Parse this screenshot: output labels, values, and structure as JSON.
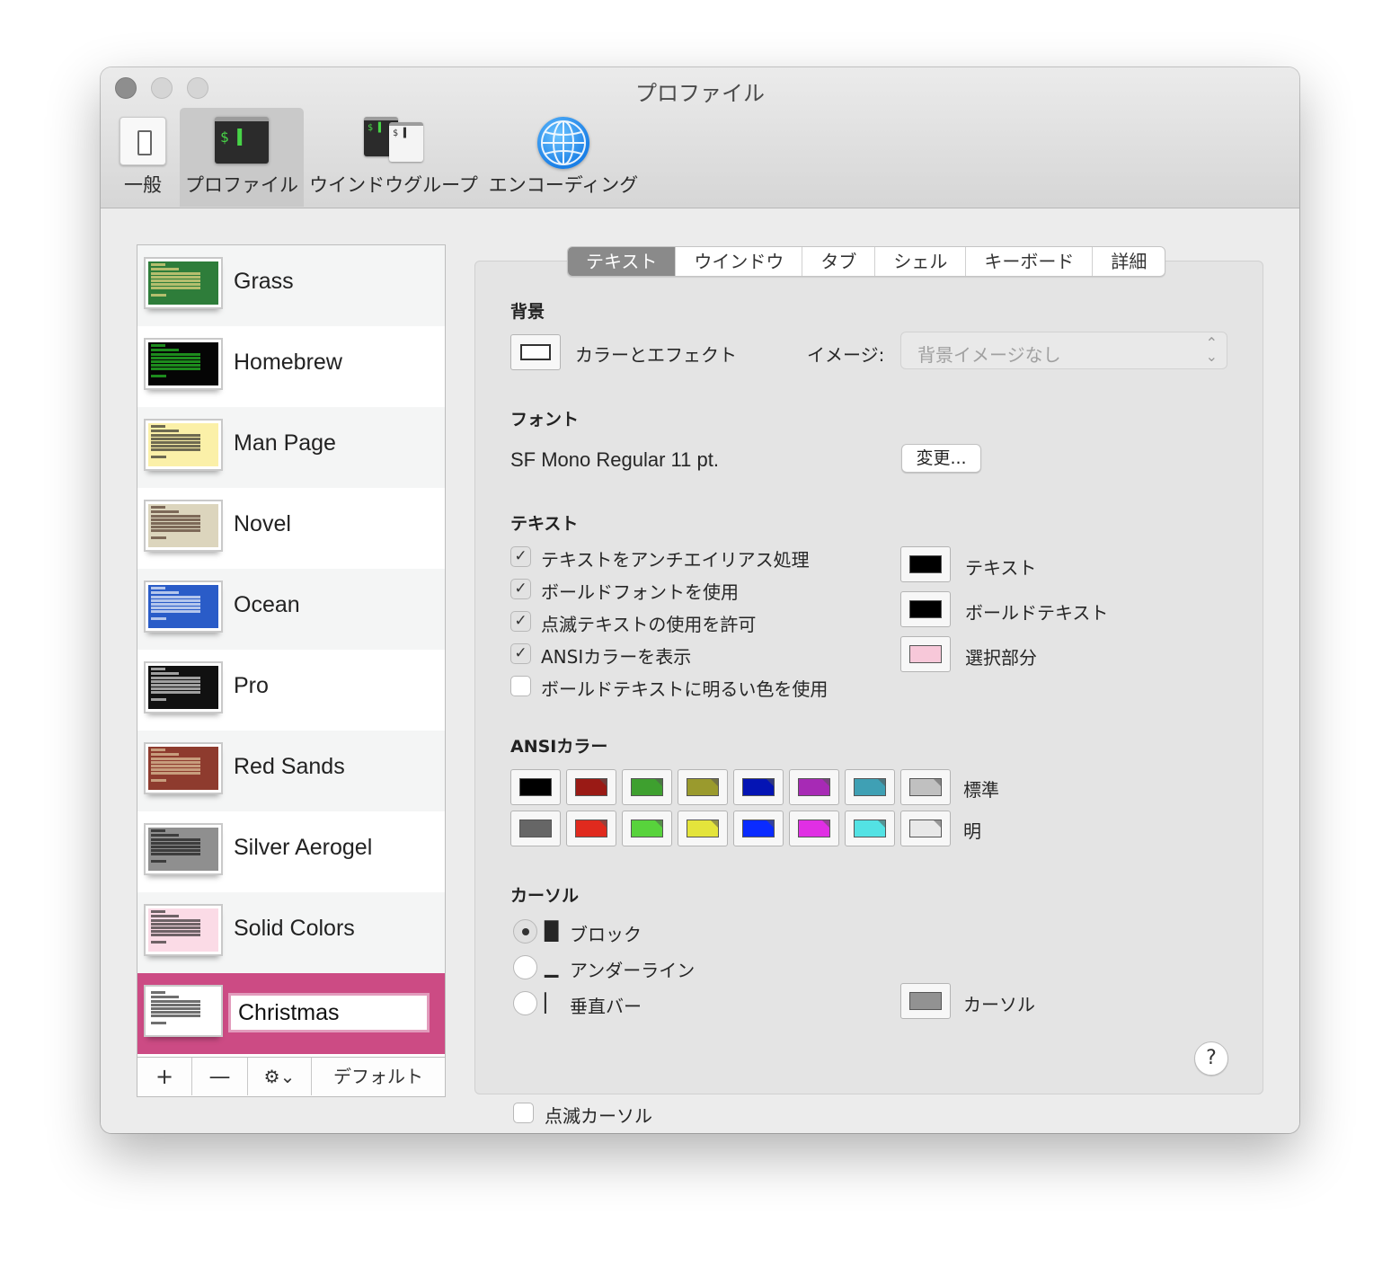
{
  "window": {
    "title": "プロファイル"
  },
  "toolbar": {
    "items": [
      {
        "label": "一般",
        "icon": "general-settings-icon"
      },
      {
        "label": "プロファイル",
        "icon": "terminal-window-icon",
        "selected": true
      },
      {
        "label": "ウインドウグループ",
        "icon": "window-group-icon"
      },
      {
        "label": "エンコーディング",
        "icon": "globe-icon"
      }
    ],
    "term_prompt": "$ ▌",
    "term_prompt_small": "$ ▌"
  },
  "profiles": {
    "items": [
      {
        "name": "Grass",
        "bg": "#2e7d3a",
        "fg": "#fde28b"
      },
      {
        "name": "Homebrew",
        "bg": "#050505",
        "fg": "#2bd62b"
      },
      {
        "name": "Man Page",
        "bg": "#fbf0a8",
        "fg": "#222222"
      },
      {
        "name": "Novel",
        "bg": "#dcd5bd",
        "fg": "#4a2f22"
      },
      {
        "name": "Ocean",
        "bg": "#2a5cc8",
        "fg": "#ffffff"
      },
      {
        "name": "Pro",
        "bg": "#111111",
        "fg": "#eeeeee"
      },
      {
        "name": "Red Sands",
        "bg": "#8e3b2e",
        "fg": "#e7d3a8"
      },
      {
        "name": "Silver Aerogel",
        "bg": "#8f8f8f",
        "fg": "#111111"
      },
      {
        "name": "Solid Colors",
        "bg": "#fbdbe6",
        "fg": "#222222"
      },
      {
        "name": "Christmas",
        "bg": "#ffffff",
        "fg": "#222222",
        "selected": true,
        "editing": true
      }
    ],
    "toolbar": {
      "add": "+",
      "remove": "—",
      "gear": "⚙⌄",
      "default": "デフォルト"
    }
  },
  "tabs": [
    "テキスト",
    "ウインドウ",
    "タブ",
    "シェル",
    "キーボード",
    "詳細"
  ],
  "active_tab": "テキスト",
  "background": {
    "title": "背景",
    "color_effects_label": "カラーとエフェクト",
    "image_label": "イメージ:",
    "image_value": "背景イメージなし",
    "arrows": "⌃⌄"
  },
  "font": {
    "title": "フォント",
    "value": "SF Mono Regular 11 pt.",
    "change_button": "変更..."
  },
  "text": {
    "title": "テキスト",
    "options": [
      {
        "label": "テキストをアンチエイリアス処理",
        "checked": true
      },
      {
        "label": "ボールドフォントを使用",
        "checked": true
      },
      {
        "label": "点滅テキストの使用を許可",
        "checked": true
      },
      {
        "label": "ANSIカラーを表示",
        "checked": true
      },
      {
        "label": "ボールドテキストに明るい色を使用",
        "checked": false
      }
    ],
    "check_mark": "✓",
    "colors": [
      {
        "label": "テキスト",
        "color": "#000000"
      },
      {
        "label": "ボールドテキスト",
        "color": "#000000"
      },
      {
        "label": "選択部分",
        "color": "#f7c8d9"
      }
    ]
  },
  "ansi": {
    "title": "ANSIカラー",
    "normal_label": "標準",
    "bright_label": "明",
    "normal": [
      "#000000",
      "#9a1a15",
      "#3ea02f",
      "#9a9a2d",
      "#0414b4",
      "#a72ab5",
      "#3fa0b4",
      "#c0c0c0"
    ],
    "bright": [
      "#666666",
      "#e02a1e",
      "#58d33c",
      "#e4e43b",
      "#0a2bff",
      "#e02fe4",
      "#53e2e4",
      "#e8e8e8"
    ]
  },
  "cursor": {
    "title": "カーソル",
    "options": [
      {
        "glyph": "█",
        "label": "ブロック",
        "selected": true
      },
      {
        "glyph": "▁",
        "label": "アンダーライン",
        "selected": false
      },
      {
        "glyph": "▏",
        "label": "垂直バー",
        "selected": false
      }
    ],
    "blink_label": "点滅カーソル",
    "color_label": "カーソル",
    "color": "#929292"
  },
  "help": "?"
}
